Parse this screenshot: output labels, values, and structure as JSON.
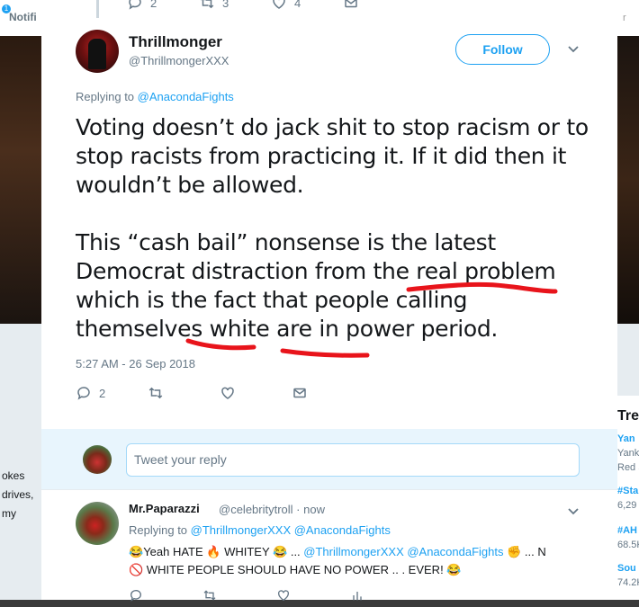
{
  "background": {
    "left_badge": "1",
    "left_nav": "Notifi",
    "left_side_texts": [
      "okes",
      "drives,",
      "my"
    ],
    "right_top": "r",
    "right_trends_title": "Tre",
    "right_items": [
      {
        "text": "Yan",
        "style": "b"
      },
      {
        "text": "Yank",
        "style": ""
      },
      {
        "text": "Red S",
        "style": ""
      },
      {
        "text": "#Sta",
        "style": "b"
      },
      {
        "text": "6,29",
        "style": ""
      },
      {
        "text": "#AH",
        "style": "b"
      },
      {
        "text": "68.5K",
        "style": ""
      },
      {
        "text": "Sou",
        "style": "b"
      },
      {
        "text": "74.2K",
        "style": ""
      }
    ]
  },
  "previous_tweet_actions": {
    "replies": "2",
    "retweets": "3",
    "likes": "4"
  },
  "tweet": {
    "name": "Thrillmonger",
    "handle": "@ThrillmongerXXX",
    "follow_label": "Follow",
    "replying_prefix": "Replying to ",
    "replying_to": "@AnacondaFights",
    "paragraphs": [
      "Voting doesn’t do jack shit to stop racism or to stop racists from practicing it. If it did then it wouldn’t be allowed.",
      "This “cash bail” nonsense is the latest Democrat distraction from the real problem which is the fact that people calling themselves white are in power period."
    ],
    "timestamp": "5:27 AM - 26 Sep 2018",
    "reply_count": "2",
    "annotation_color": "#e8141b"
  },
  "reply_box": {
    "placeholder": "Tweet your reply"
  },
  "comment": {
    "name": "Mr.Paparazzi",
    "handle": "@celebritytroll · now",
    "replying_prefix": "Replying to ",
    "replying_to": "@ThrillmongerXXX @AnacondaFights",
    "line1_a": "Yeah HATE ",
    "line1_b": " WHITEY ",
    "line1_c": " ... ",
    "line1_link": "@ThrillmongerXXX @AnacondaFights",
    "line1_d": " ... N",
    "line2": " WHITE PEOPLE SHOULD HAVE NO POWER ..  . EVER! "
  },
  "colors": {
    "accent": "#1da1f2",
    "text": "#14171a",
    "muted": "#657786"
  }
}
